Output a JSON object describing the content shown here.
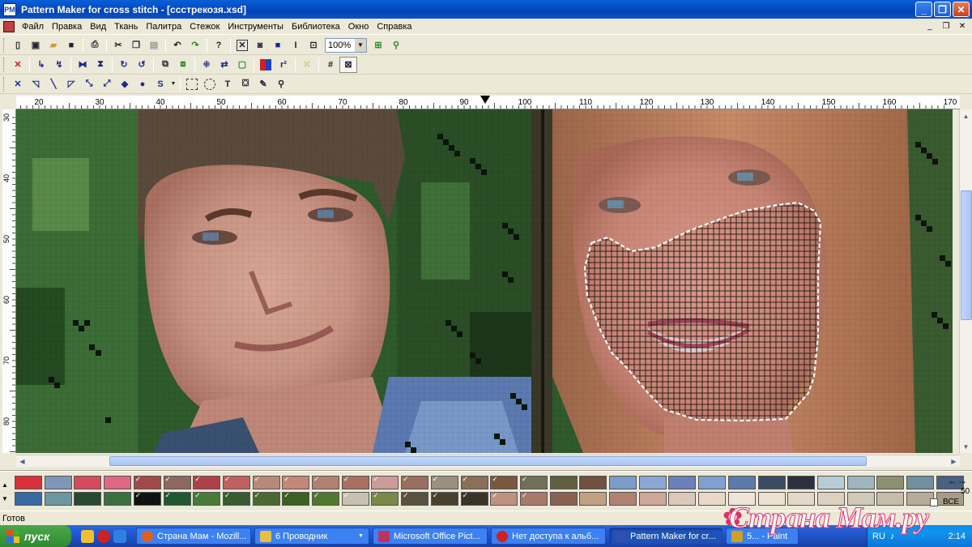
{
  "window": {
    "title": "Pattern Maker for cross stitch - [ccстрекозя.xsd]",
    "buttons": [
      "_",
      "❐",
      "✕"
    ]
  },
  "menu": {
    "items": [
      "Файл",
      "Правка",
      "Вид",
      "Ткань",
      "Палитра",
      "Стежок",
      "Инструменты",
      "Библиотека",
      "Окно",
      "Справка"
    ],
    "mdi_buttons": [
      "_",
      "❐",
      "✕"
    ]
  },
  "toolbar1": {
    "icons": [
      "new-icon",
      "new-pattern-icon",
      "open-icon",
      "save-icon",
      "print-icon",
      "cut-icon",
      "copy-icon",
      "paste-icon",
      "undo-icon",
      "redo-icon",
      "help-icon",
      "stitch-full-icon",
      "stitch-half-icon",
      "stitch-fill-icon",
      "text-cursor-icon",
      "zoom-fit-icon",
      "zoom-icon"
    ],
    "zoom_value": "100%"
  },
  "toolbar2": {
    "icons": [
      "delete-icon",
      "shift-icon",
      "rotate-x-icon",
      "flip-h-icon",
      "flip-v-icon",
      "rotate-cw-icon",
      "rotate-ccw-icon",
      "select-color-icon",
      "replace-color-icon",
      "grid-toggle-icon",
      "mirror-icon",
      "frame-icon",
      "palette-icon",
      "count-icon",
      "dotted-icon",
      "grid-icon",
      "crossed-icon"
    ]
  },
  "toolbar3": {
    "icons": [
      "cross-icon",
      "quarter-icon",
      "line-icon",
      "backstitch-icon",
      "diagonal-icon",
      "long-stitch-icon",
      "bead-icon",
      "knot-icon",
      "s-stitch-icon",
      "rect-select-icon",
      "lasso-icon",
      "text-icon",
      "fill-icon",
      "eyedropper-icon",
      "magnifier-icon"
    ],
    "text_glyph": "T",
    "s_glyph": "S"
  },
  "ruler": {
    "h_labels": [
      "20",
      "30",
      "40",
      "50",
      "60",
      "70",
      "80",
      "90",
      "100",
      "110",
      "120",
      "130",
      "140",
      "150",
      "160",
      "170"
    ],
    "v_labels": [
      "30",
      "40",
      "50",
      "60",
      "70",
      "80"
    ]
  },
  "palette": {
    "row1": [
      "#d8303a",
      "#7f96b4",
      "#d64a5e",
      "#e06882",
      "#a24a4a",
      "#8c6860",
      "#b04048",
      "#c06060",
      "#b88878",
      "#c48878",
      "#b08070",
      "#a87060",
      "#cc9a98",
      "#9a6e60",
      "#9a9080",
      "#8a7058",
      "#7a5840",
      "#707058",
      "#606040",
      "#705040",
      "#7a9cc8",
      "#8aa8d4",
      "#6a80b8",
      "#80a0d0",
      "#5a7aa8",
      "#3a4a60",
      "#2a3040",
      "#b8ccd8",
      "#a0b4c0",
      "#8a9070",
      "#7090a0",
      "#4a6080"
    ],
    "row2": [
      "#3868a0",
      "#6a98a0",
      "#284830",
      "#3a7040",
      "#101410",
      "#205830",
      "#4a7a38",
      "#3a5a30",
      "#4a6830",
      "#3c6020",
      "#50782c",
      "#c8c0b0",
      "#7a8848",
      "#5a5040",
      "#4a4030",
      "#3a3428",
      "#c09080",
      "#a87868",
      "#8a6050",
      "#c0a080",
      "#b08070",
      "#cca898",
      "#dcc8b8",
      "#e8d8c8",
      "#f0e4d8",
      "#ece0d0",
      "#e4d8c8",
      "#dcd0c0",
      "#d0c8b8",
      "#c8bca8",
      "#b8ac98",
      "#a89c88"
    ],
    "checked_row1": [
      4,
      5,
      6,
      7,
      8,
      9,
      10,
      11,
      12,
      13,
      14,
      15,
      16,
      17
    ],
    "checked_row2": [
      4,
      5,
      6,
      7,
      8,
      9,
      10,
      11,
      12,
      13,
      14,
      15,
      16,
      17
    ]
  },
  "palette_controls": {
    "arrows": "←→",
    "count": "50",
    "all_label": "ВСЕ"
  },
  "status": {
    "text": "Готов"
  },
  "taskbar": {
    "start_label": "пуск",
    "tasks": [
      {
        "label": "Страна Мам - Mozill...",
        "color": "#e06020"
      },
      {
        "label": "6 Проводник",
        "color": "#e8c040"
      },
      {
        "label": "Microsoft Office Pict...",
        "color": "#c03060"
      },
      {
        "label": "Нет доступа к альб...",
        "color": "#d02020"
      },
      {
        "label": "Pattern Maker for cr...",
        "color": "#3050b0"
      },
      {
        "label": "5... - Paint",
        "color": "#d0a020"
      }
    ],
    "tray_lang": "RU",
    "tray_time": "2:14"
  },
  "watermark": {
    "text": "Страна Мам.ру"
  },
  "colors": {
    "titlebar": "#0a5fd8",
    "selection_outline": "#ffffff",
    "canvas_bg": "#2d5a2d"
  }
}
